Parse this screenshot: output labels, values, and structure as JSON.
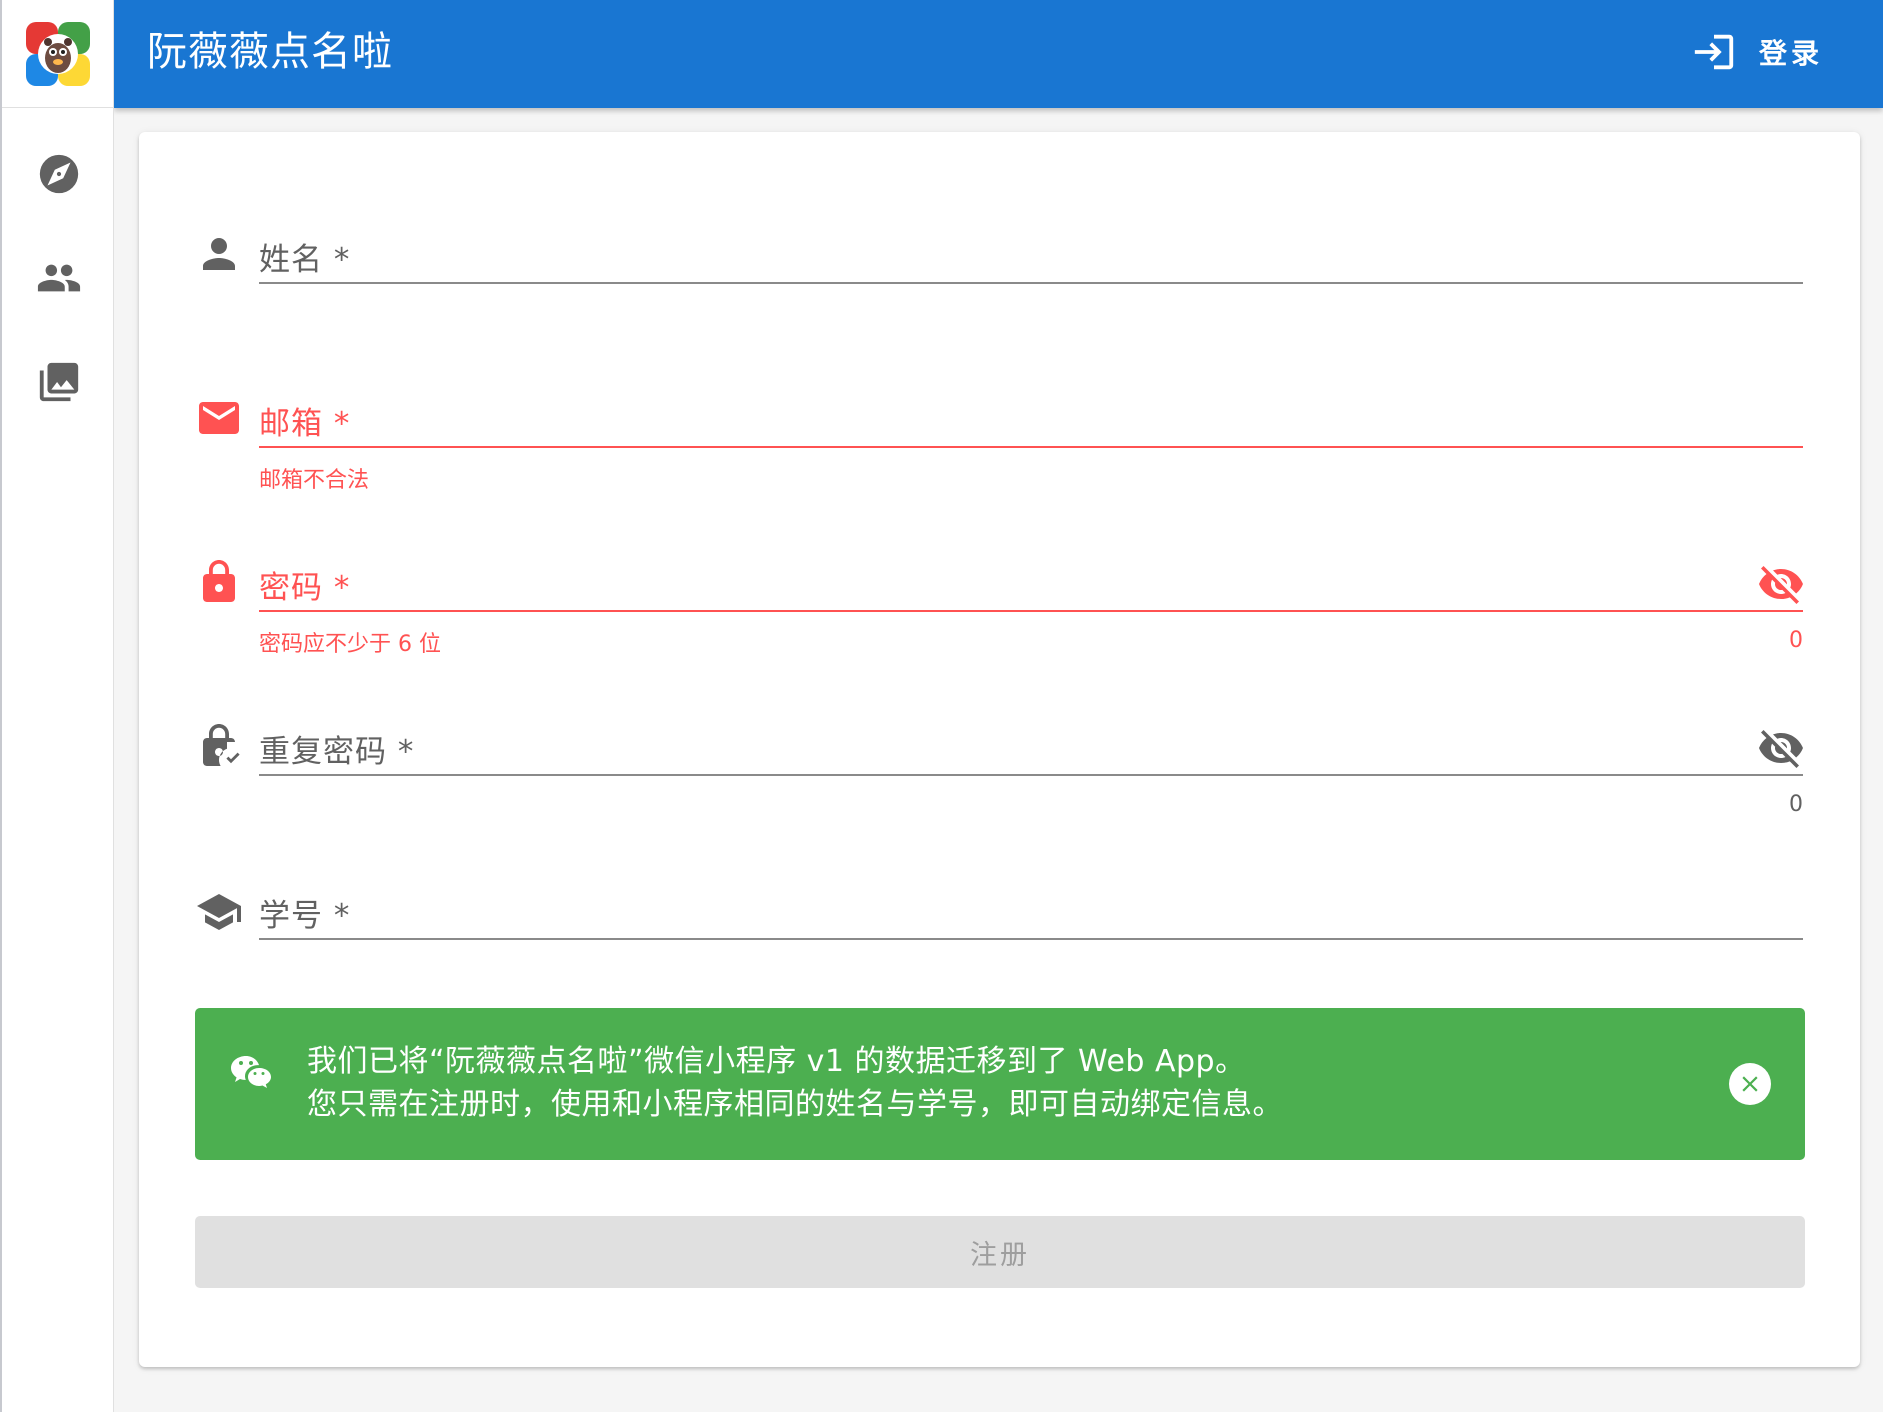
{
  "app": {
    "title": "阮薇薇点名啦",
    "accent_color": "#1976d2",
    "error_color": "#ff5252",
    "success_color": "#4caf50"
  },
  "header": {
    "login_label": "登录",
    "login_icon": "login-icon"
  },
  "rail": {
    "logo": "app-logo",
    "items": [
      {
        "icon": "compass-icon",
        "name": "explore"
      },
      {
        "icon": "people-icon",
        "name": "groups"
      },
      {
        "icon": "photo-library-icon",
        "name": "gallery"
      }
    ]
  },
  "form": {
    "name": {
      "label": "姓名 *",
      "icon": "person-icon",
      "value": ""
    },
    "email": {
      "label": "邮箱 *",
      "icon": "email-icon",
      "value": "",
      "error": "邮箱不合法"
    },
    "password": {
      "label": "密码 *",
      "icon": "lock-icon",
      "value": "",
      "error": "密码应不少于 6 位",
      "counter": "0"
    },
    "repeat_password": {
      "label": "重复密码 *",
      "icon": "lock-check-icon",
      "value": "",
      "counter": "0"
    },
    "student_id": {
      "label": "学号 *",
      "icon": "school-icon",
      "value": ""
    }
  },
  "alert": {
    "icon": "wechat-icon",
    "line1": "我们已将“阮薇薇点名啦”微信小程序 v1 的数据迁移到了 Web App。",
    "line2": "您只需在注册时，使用和小程序相同的姓名与学号，即可自动绑定信息。"
  },
  "submit": {
    "label": "注册",
    "disabled": true
  }
}
